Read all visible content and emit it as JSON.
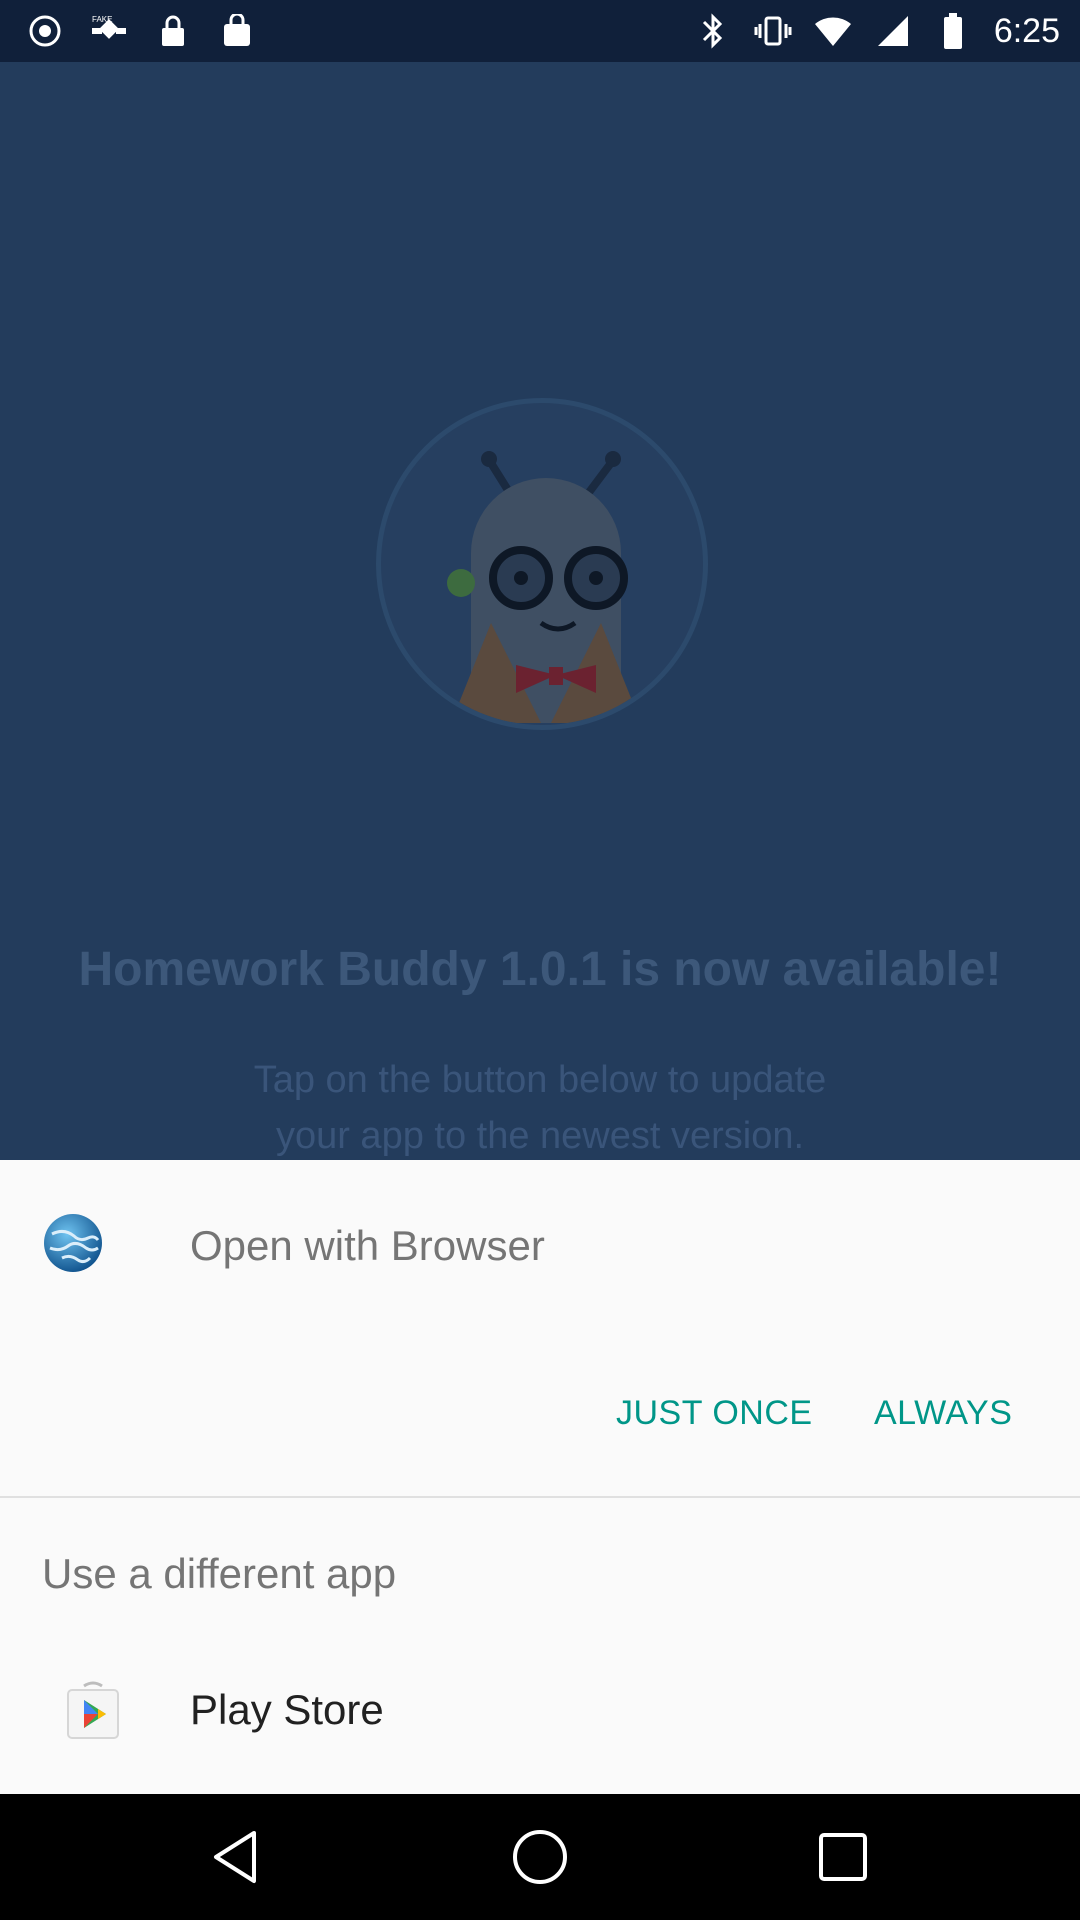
{
  "status_bar": {
    "time": "6:25",
    "icons": [
      "location-sync-icon",
      "fake-gps-icon",
      "lock-icon",
      "bag-icon",
      "bluetooth-icon",
      "vibrate-icon",
      "wifi-icon",
      "cell-signal-icon",
      "battery-icon"
    ]
  },
  "background_app": {
    "headline": "Homework Buddy 1.0.1 is now available!",
    "subline_1": "Tap on the button below to update",
    "subline_2": "your app to the newest version."
  },
  "chooser": {
    "title": "Open with Browser",
    "just_once_label": "JUST ONCE",
    "always_label": "ALWAYS",
    "different_app_title": "Use a different app",
    "apps": [
      {
        "label": "Play Store",
        "icon": "play-store-icon"
      }
    ],
    "accent_color": "#009688"
  },
  "nav_bar": {
    "buttons": [
      "back-icon",
      "home-icon",
      "recents-icon"
    ]
  }
}
